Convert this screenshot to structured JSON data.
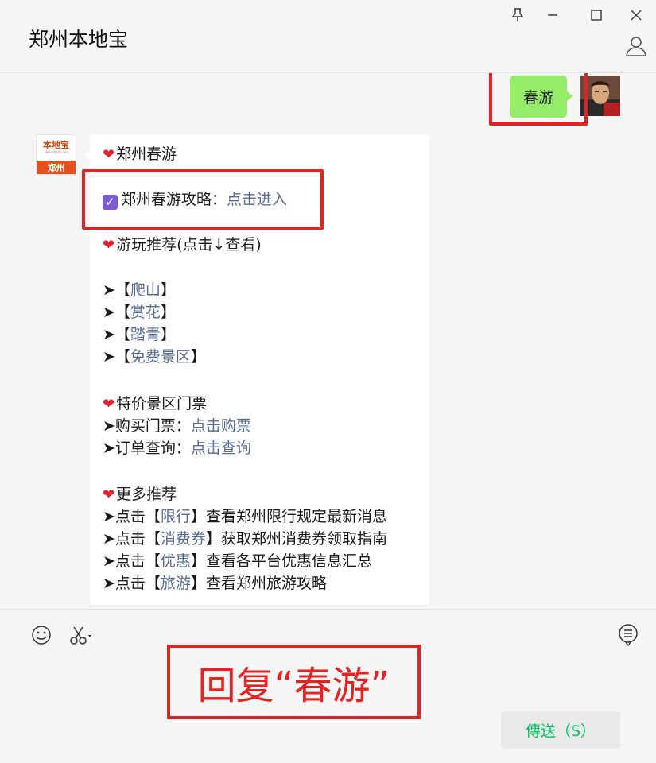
{
  "window": {
    "title": "郑州本地宝",
    "controls": {
      "pin_icon": "pin-icon",
      "minimize_icon": "minimize-icon",
      "maximize_icon": "maximize-icon",
      "close_icon": "close-icon"
    },
    "profile_icon": "person-outline-icon"
  },
  "chat": {
    "sent_message": "春游",
    "bot_avatar": {
      "top_text": "本地宝",
      "small_text": "Bendibao.com",
      "bottom_text": "郑州"
    },
    "reply": {
      "section1_title": "郑州春游",
      "guide_label": "郑州春游攻略：",
      "guide_link": "点击进入",
      "section2_title": "游玩推荐(点击↓查看)",
      "rec_items": [
        "爬山",
        "赏花",
        "踏青",
        "免费景区"
      ],
      "section3_title": "特价景区门票",
      "buy_label": "➤购买门票：",
      "buy_link": "点击购票",
      "order_label": "➤订单查询：",
      "order_link": "点击查询",
      "section4_title": "更多推荐",
      "more_items": [
        {
          "prefix": "➤点击【",
          "link": "限行",
          "suffix": "】查看郑州限行规定最新消息"
        },
        {
          "prefix": "➤点击【",
          "link": "消费券",
          "suffix": "】获取郑州消费券领取指南"
        },
        {
          "prefix": "➤点击【",
          "link": "优惠",
          "suffix": "】查看各平台优惠信息汇总"
        },
        {
          "prefix": "➤点击【",
          "link": "旅游",
          "suffix": "】查看郑州旅游攻略"
        }
      ]
    }
  },
  "input": {
    "tools": [
      "emoji-icon",
      "scissors-icon",
      "chat-history-icon"
    ],
    "annotation": "回复“春游”",
    "send_label": "傳送（S）"
  },
  "colors": {
    "accent_green": "#07c160",
    "bubble_green": "#95ec69",
    "link_blue": "#576b95",
    "highlight_red": "#e62121"
  }
}
